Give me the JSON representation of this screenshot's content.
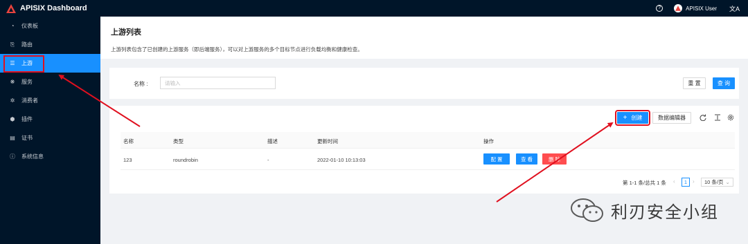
{
  "app": {
    "title": "APISIX Dashboard",
    "user": "APISIX User",
    "help_glyph": "?",
    "lang_glyph": "文A"
  },
  "sidebar": {
    "items": [
      {
        "label": "仪表板",
        "icon": "dashboard-icon",
        "glyph": "◔"
      },
      {
        "label": "路由",
        "icon": "route-icon",
        "glyph": "⎘"
      },
      {
        "label": "上游",
        "icon": "upstream-icon",
        "glyph": "☰"
      },
      {
        "label": "服务",
        "icon": "service-icon",
        "glyph": "❋"
      },
      {
        "label": "消费者",
        "icon": "consumer-icon",
        "glyph": "✲"
      },
      {
        "label": "插件",
        "icon": "plugin-icon",
        "glyph": "⬢"
      },
      {
        "label": "证书",
        "icon": "certificate-icon",
        "glyph": "▤"
      },
      {
        "label": "系统信息",
        "icon": "info-icon",
        "glyph": "ⓘ"
      }
    ],
    "active": "上游"
  },
  "page": {
    "title": "上游列表",
    "description": "上游列表包含了已创建的上游服务（即后端服务），可以对上游服务的多个目标节点进行负载均衡和健康检查。"
  },
  "search": {
    "label": "名称 :",
    "placeholder": "请输入",
    "reset_label": "重 置",
    "query_label": "查 询"
  },
  "toolbar": {
    "create_plus": "+",
    "create_label": "创建",
    "editor_label": "数据编辑器",
    "reload_icon": "reload-icon",
    "density_icon": "column-height-icon",
    "setting_icon": "setting-icon"
  },
  "table": {
    "columns": [
      "名称",
      "类型",
      "描述",
      "更新时间",
      "操作"
    ],
    "rows": [
      {
        "name": "123",
        "type": "roundrobin",
        "desc": "-",
        "updated": "2022-01-10 10:13:03"
      }
    ],
    "actions": {
      "config": "配 置",
      "view": "查 看",
      "delete": "删 除"
    }
  },
  "pagination": {
    "total_text": "第 1-1 条/总共 1 条",
    "prev": "‹",
    "current": "1",
    "next": "›",
    "page_size": "10 条/页",
    "caret": "⌄"
  },
  "watermark": {
    "text": "利刃安全小组",
    "icon": "wechat-icon"
  },
  "colors": {
    "nav_bg": "#001529",
    "primary": "#1890ff",
    "danger": "#ff4d4f",
    "annotation_red": "#e0101f",
    "page_bg": "#f0f2f5"
  }
}
